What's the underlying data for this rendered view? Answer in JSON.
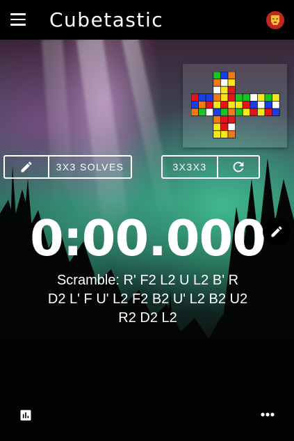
{
  "app": {
    "title": "Cubetastic"
  },
  "toolbar": {
    "edit_session_label": "",
    "session_label": "3X3 SOLVES",
    "puzzle_label": "3X3X3"
  },
  "timer": {
    "display": "0:00.000"
  },
  "scramble": {
    "prefix": "Scramble: ",
    "line1": "Scramble: R' F2 L2 U L2 B' R",
    "line2": "D2 L' F U' L2 F2 B2 U' L2 B2 U2",
    "line3": "R2 D2 L2"
  },
  "cube_net": {
    "colors": {
      "W": "#ffffff",
      "Y": "#f6e61a",
      "R": "#e3151b",
      "O": "#f07b16",
      "G": "#19c420",
      "B": "#1a3ee6"
    },
    "U": [
      "GBO",
      "OWY",
      "WYR"
    ],
    "L": [
      "RBB",
      "BOR",
      "OGW"
    ],
    "F": [
      "OYR",
      "YRY",
      "BGO"
    ],
    "R": [
      "GGW",
      "YRB",
      "GYR"
    ],
    "B": [
      "YGY",
      "WBW",
      "YRB"
    ],
    "D": [
      "ORR",
      "YRW",
      "YYO"
    ]
  },
  "icons": {
    "menu": "menu-icon",
    "avatar": "iron-man-avatar-icon",
    "pencil": "pencil-icon",
    "refresh": "refresh-icon",
    "stats": "bar-chart-icon",
    "more": "more-horizontal-icon"
  }
}
